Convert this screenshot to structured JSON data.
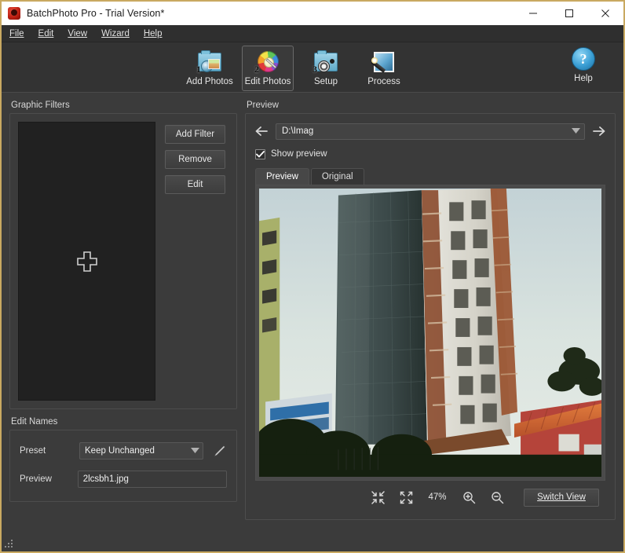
{
  "window": {
    "title": "BatchPhoto Pro - Trial Version*",
    "app_icon": "batchphoto-logo-icon",
    "minimize": "minimize-icon",
    "maximize": "maximize-icon",
    "close": "close-icon",
    "border_color": "#c9a961"
  },
  "menubar": {
    "items": [
      {
        "label": "File",
        "accel": "F"
      },
      {
        "label": "Edit",
        "accel": "E"
      },
      {
        "label": "View",
        "accel": "V"
      },
      {
        "label": "Wizard",
        "accel": "z"
      },
      {
        "label": "Help",
        "accel": "H"
      }
    ]
  },
  "toolbar": {
    "buttons": [
      {
        "label": "Add Photos",
        "step": "1",
        "icon": "camera-add-photos-icon",
        "selected": false
      },
      {
        "label": "Edit Photos",
        "step": "2",
        "icon": "color-palette-brush-icon",
        "selected": true
      },
      {
        "label": "Setup",
        "step": "3",
        "icon": "camera-gear-setup-icon",
        "selected": false
      },
      {
        "label": "Process",
        "step": "",
        "icon": "magic-wand-process-icon",
        "selected": false
      }
    ],
    "help": {
      "label": "Help",
      "glyph": "?",
      "icon": "help-question-icon"
    }
  },
  "left_panel": {
    "filters": {
      "title": "Graphic Filters",
      "empty_cursor_icon": "plus-cursor-icon",
      "buttons": [
        {
          "label": "Add Filter",
          "name": "add-filter-button"
        },
        {
          "label": "Remove",
          "name": "remove-filter-button"
        },
        {
          "label": "Edit",
          "name": "edit-filter-button"
        }
      ]
    },
    "edit_names": {
      "title": "Edit Names",
      "preset_label": "Preset",
      "preset_value": "Keep Unchanged",
      "preset_options": [
        "Keep Unchanged"
      ],
      "edit_icon": "pencil-edit-icon",
      "preview_label": "Preview",
      "preview_value": "2lcsbh1.jpg"
    }
  },
  "preview_panel": {
    "title": "Preview",
    "back_icon": "arrow-left-icon",
    "forward_icon": "arrow-right-icon",
    "path_value": "D:\\Imag",
    "path_options": [
      "D:\\Imag"
    ],
    "show_preview_label": "Show preview",
    "show_preview_accel": "o",
    "show_preview_checked": true,
    "tabs": [
      {
        "label": "Preview",
        "active": true
      },
      {
        "label": "Original",
        "active": false
      }
    ],
    "image": {
      "alt": "photo of a glass office tower and a high-rise building under construction with scaffolding, a red tile-roofed house and trees"
    },
    "zoom": {
      "fit_in_icon": "fit-inward-arrows-icon",
      "fit_out_icon": "expand-outward-arrows-icon",
      "level": "47%",
      "zoom_in_icon": "magnifier-plus-icon",
      "zoom_out_icon": "magnifier-minus-icon"
    },
    "switch_view": {
      "label": "Switch View",
      "accel": "w"
    }
  },
  "statusbar": {
    "text": "",
    "grip_icon": "resize-grip-icon"
  }
}
